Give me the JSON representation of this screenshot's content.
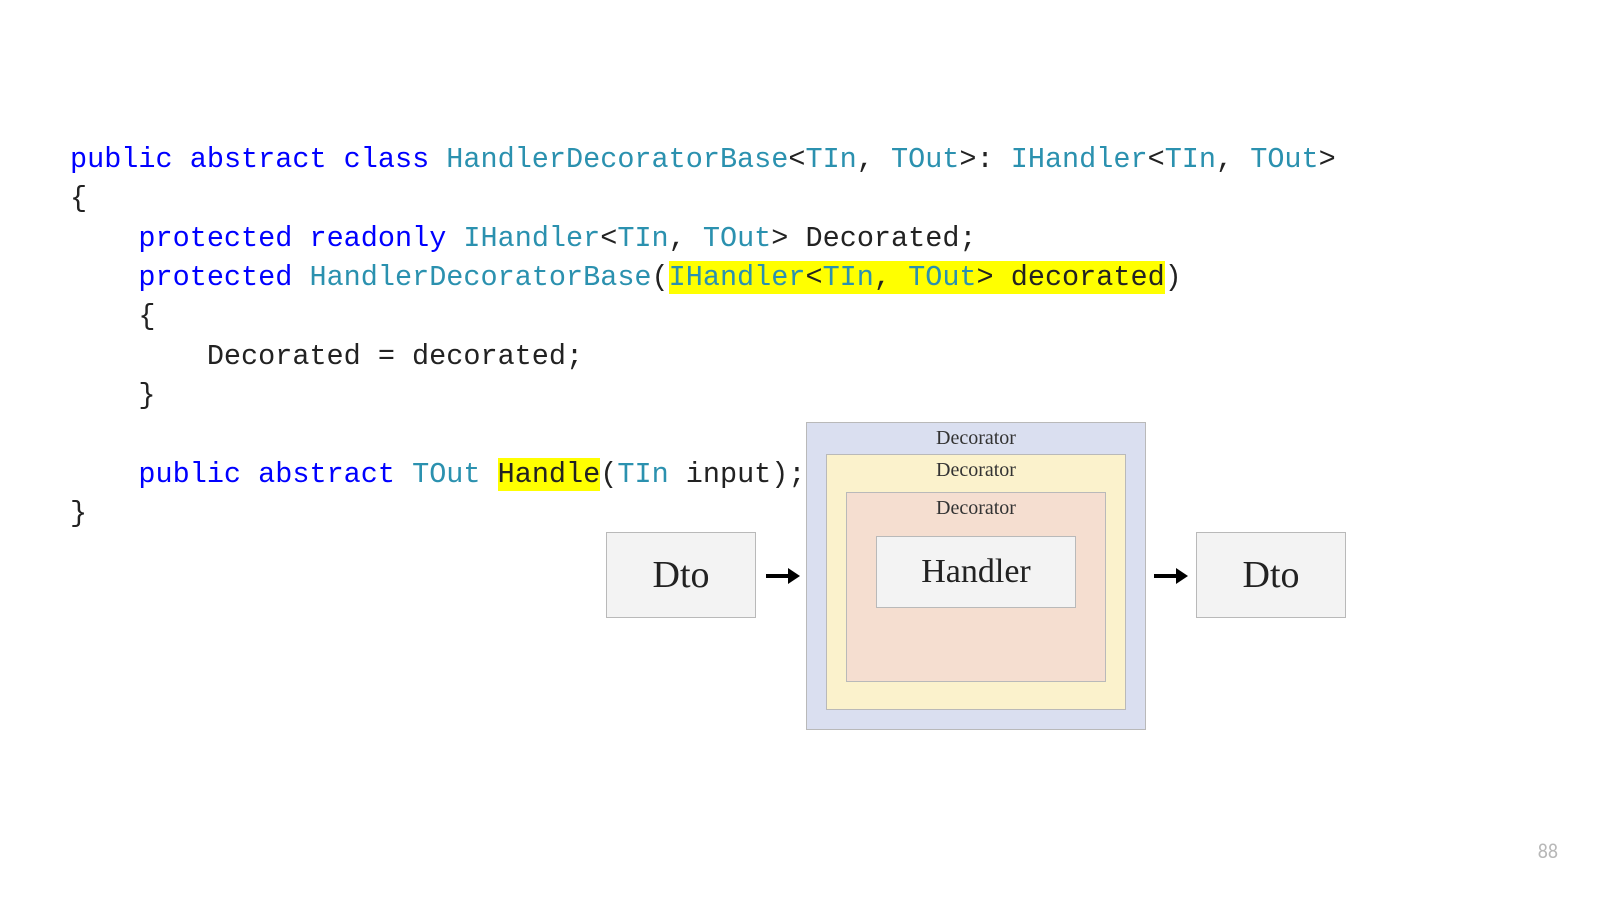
{
  "code": {
    "l1_public": "public",
    "l1_abstract": "abstract",
    "l1_class": "class",
    "l1_name": "HandlerDecoratorBase",
    "l1_lt1": "<",
    "l1_tin": "TIn",
    "l1_comma": ", ",
    "l1_tout": "TOut",
    "l1_gt1": ">",
    "l1_colon": ": ",
    "l1_iface": "IHandler",
    "l1_lt2": "<",
    "l1_tin2": "TIn",
    "l1_comma2": ", ",
    "l1_tout2": "TOut",
    "l1_gt2": ">",
    "l2_brace": "{",
    "l3_protected": "protected",
    "l3_readonly": "readonly",
    "l3_iface": "IHandler",
    "l3_lt": "<",
    "l3_tin": "TIn",
    "l3_comma": ", ",
    "l3_tout": "TOut",
    "l3_gt": ">",
    "l3_field": " Decorated;",
    "l4_protected": "protected",
    "l4_name": "HandlerDecoratorBase",
    "l4_paren": "(",
    "l4_hl_iface": "IHandler",
    "l4_hl_lt": "<",
    "l4_hl_tin": "TIn",
    "l4_hl_comma": ", ",
    "l4_hl_tout": "TOut",
    "l4_hl_gt": ">",
    "l4_hl_param": " decorated",
    "l4_close": ")",
    "l5_brace": "{",
    "l6_body": "Decorated = decorated;",
    "l7_brace": "}",
    "l8_public": "public",
    "l8_abstract": "abstract",
    "l8_tout": "TOut",
    "l8_hl": "Handle",
    "l8_paren": "(",
    "l8_tin": "TIn",
    "l8_rest": " input);",
    "l9_brace": "}"
  },
  "diagram": {
    "decorator1": "Decorator",
    "decorator2": "Decorator",
    "decorator3": "Decorator",
    "handler": "Handler",
    "dto": "Dto"
  },
  "page": "88"
}
